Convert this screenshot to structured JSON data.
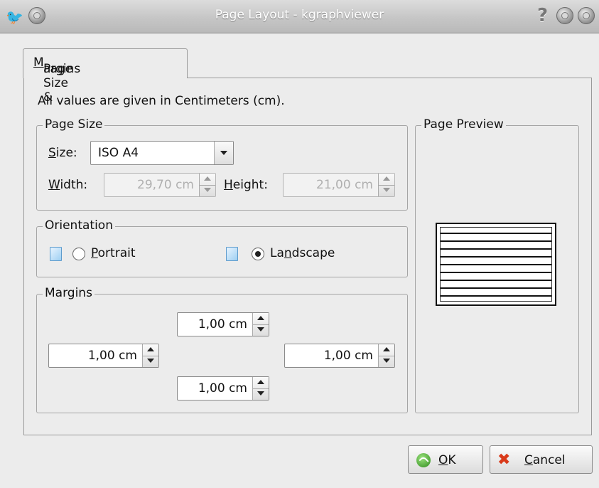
{
  "window": {
    "title": "Page Layout - kgraphviewer",
    "help_glyph": "?",
    "app_icon_glyph": "🐦"
  },
  "tabs": [
    {
      "label_prefix": "Page Size & ",
      "label_mnemonic": "M",
      "label_suffix": "argins"
    }
  ],
  "info_text": "All values are given in Centimeters (cm).",
  "page_size": {
    "legend": "Page Size",
    "size_label_mnemonic": "S",
    "size_label_rest": "ize:",
    "size_value": "ISO A4",
    "width_label_mnemonic": "W",
    "width_label_rest": "idth:",
    "width_value": "29,70 cm",
    "height_label_mnemonic": "H",
    "height_label_rest": "eight:",
    "height_value": "21,00 cm"
  },
  "orientation": {
    "legend": "Orientation",
    "portrait_mnemonic": "P",
    "portrait_rest": "ortrait",
    "landscape_prefix": "La",
    "landscape_mnemonic": "n",
    "landscape_rest": "dscape",
    "selected": "landscape"
  },
  "margins": {
    "legend": "Margins",
    "top": "1,00 cm",
    "left": "1,00 cm",
    "right": "1,00 cm",
    "bottom": "1,00 cm"
  },
  "preview": {
    "legend": "Page Preview"
  },
  "buttons": {
    "ok_mnemonic": "O",
    "ok_rest": "K",
    "cancel_mnemonic": "C",
    "cancel_rest": "ancel"
  }
}
